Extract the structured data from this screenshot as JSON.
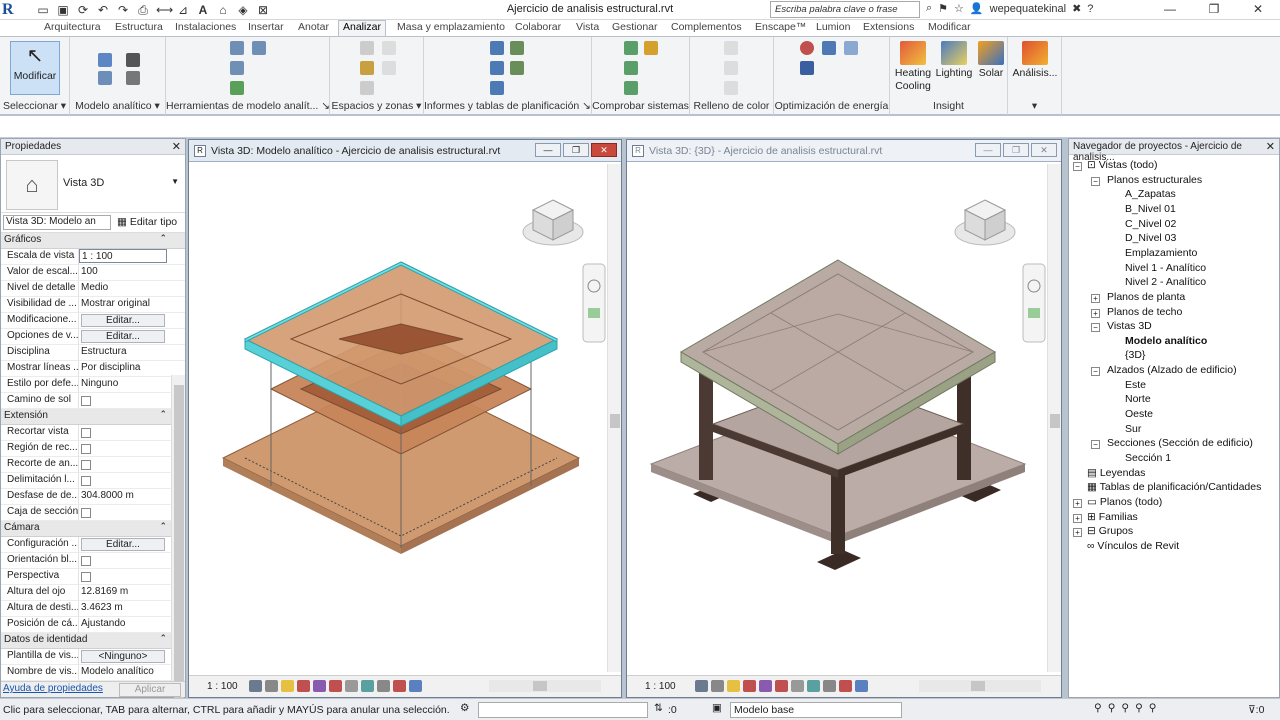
{
  "app": {
    "logo": "R",
    "title": "Ajercicio de analisis estructural.rvt"
  },
  "quick_access": [
    "open-icon",
    "save-icon",
    "sync-icon",
    "undo-icon",
    "redo-icon",
    "measure-icon",
    "dimension-icon",
    "text-icon",
    "3d-icon",
    "section-icon",
    "close-icon"
  ],
  "search": {
    "placeholder": "Escriba palabra clave o frase"
  },
  "user": {
    "name": "wepequatekinal"
  },
  "window_controls": [
    "minimize",
    "restore",
    "close"
  ],
  "tabs": [
    "Arquitectura",
    "Estructura",
    "Instalaciones",
    "Insertar",
    "Anotar",
    "Analizar",
    "Masa y emplazamiento",
    "Colaborar",
    "Vista",
    "Gestionar",
    "Complementos",
    "Enscape™",
    "Lumion",
    "Extensions",
    "Modificar"
  ],
  "active_tab": "Analizar",
  "ribbon": {
    "modify_label": "Modificar",
    "groups": [
      "Seleccionar ▾",
      "Modelo analítico ▾",
      "Herramientas de modelo analít... ↘",
      "Espacios y zonas ▾",
      "Informes y tablas de planificación ↘",
      "Comprobar sistemas",
      "Relleno de color",
      "Optimización de energía",
      "Insight",
      "▾"
    ],
    "insight_buttons": [
      {
        "label": "Heating\nCooling",
        "l1": "Heating",
        "l2": "Cooling"
      },
      {
        "label": "Lighting"
      },
      {
        "label": "Solar"
      },
      {
        "label": "Análisis..."
      }
    ]
  },
  "properties": {
    "title": "Propiedades",
    "type_name": "Vista 3D",
    "instance": "Vista 3D: Modelo an",
    "edit_type": "Editar tipo",
    "sections": {
      "graficos": "Gráficos",
      "extension": "Extensión",
      "camara": "Cámara",
      "identidad": "Datos de identidad"
    },
    "graficos": [
      {
        "name": "Escala de vista",
        "value": "1 : 100"
      },
      {
        "name": "Valor de escal...",
        "value": "100"
      },
      {
        "name": "Nivel de detalle",
        "value": "Medio"
      },
      {
        "name": "Visibilidad de ...",
        "value": "Mostrar original"
      },
      {
        "name": "Modificacione...",
        "value": "Editar..."
      },
      {
        "name": "Opciones de v...",
        "value": "Editar..."
      },
      {
        "name": "Disciplina",
        "value": "Estructura"
      },
      {
        "name": "Mostrar líneas ...",
        "value": "Por disciplina"
      },
      {
        "name": "Estilo por defe...",
        "value": "Ninguno"
      },
      {
        "name": "Camino de sol",
        "value": ""
      }
    ],
    "extension": [
      {
        "name": "Recortar vista",
        "value": ""
      },
      {
        "name": "Región de rec...",
        "value": ""
      },
      {
        "name": "Recorte de an...",
        "value": ""
      },
      {
        "name": "Delimitación l...",
        "value": ""
      },
      {
        "name": "Desfase de de...",
        "value": "304.8000 m"
      },
      {
        "name": "Caja de sección",
        "value": ""
      }
    ],
    "camara": [
      {
        "name": "Configuración ...",
        "value": "Editar..."
      },
      {
        "name": "Orientación bl...",
        "value": ""
      },
      {
        "name": "Perspectiva",
        "value": ""
      },
      {
        "name": "Altura del ojo",
        "value": "12.8169 m"
      },
      {
        "name": "Altura de desti...",
        "value": "3.4623 m"
      },
      {
        "name": "Posición de cá...",
        "value": "Ajustando"
      }
    ],
    "identidad": [
      {
        "name": "Plantilla de vis...",
        "value": "<Ninguno>"
      },
      {
        "name": "Nombre de vis...",
        "value": "Modelo analítico"
      }
    ],
    "help": "Ayuda de propiedades",
    "apply": "Aplicar"
  },
  "views": [
    {
      "title": "Vista 3D: Modelo analítico - Ajercicio de analisis estructural.rvt",
      "scale": "1 : 100"
    },
    {
      "title": "Vista 3D: {3D} - Ajercicio de analisis estructural.rvt",
      "scale": "1 : 100"
    }
  ],
  "browser": {
    "title": "Navegador de proyectos - Ajercicio de analisis...",
    "items": {
      "vistas": "Vistas (todo)",
      "planos_est": "Planos estructurales",
      "a_zapatas": "A_Zapatas",
      "b_nivel01": "B_Nivel 01",
      "c_nivel02": "C_Nivel 02",
      "d_nivel03": "D_Nivel 03",
      "emplazamiento": "Emplazamiento",
      "nivel1_an": "Nivel 1 - Analítico",
      "nivel2_an": "Nivel 2 - Analítico",
      "planos_planta": "Planos de planta",
      "planos_techo": "Planos de techo",
      "vistas3d": "Vistas 3D",
      "modelo_an": "Modelo analítico",
      "v3d": "{3D}",
      "alzados": "Alzados (Alzado de edificio)",
      "este": "Este",
      "norte": "Norte",
      "oeste": "Oeste",
      "sur": "Sur",
      "secciones": "Secciones (Sección de edificio)",
      "seccion1": "Sección 1",
      "leyendas": "Leyendas",
      "tablas": "Tablas de planificación/Cantidades",
      "planos": "Planos (todo)",
      "familias": "Familias",
      "grupos": "Grupos",
      "vinculos": "Vínculos de Revit"
    }
  },
  "status": {
    "text": "Clic para seleccionar, TAB para alternar, CTRL para añadir y MAYÚS para anular una selección.",
    "zero": ":0",
    "model": "Modelo base"
  },
  "colors": {
    "accent": "#1b4f9c",
    "slab_orange": "#c98a5b",
    "slab_cyan": "#5fd3da",
    "concrete": "#b9aaa4",
    "column": "#4b3a33"
  }
}
